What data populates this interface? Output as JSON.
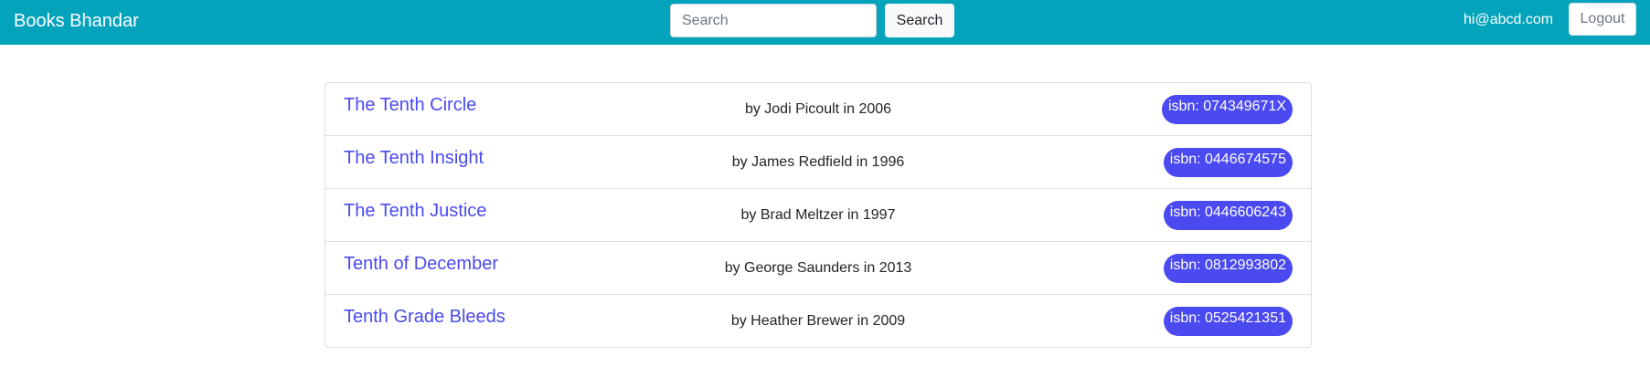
{
  "navbar": {
    "brand": "Books Bhandar",
    "search_placeholder": "Search",
    "search_value": "",
    "search_button_label": "Search",
    "user_email": "hi@abcd.com",
    "logout_label": "Logout"
  },
  "books": [
    {
      "title": "The Tenth Circle",
      "byline": "by Jodi Picoult in 2006",
      "isbn": "isbn: 074349671X"
    },
    {
      "title": "The Tenth Insight",
      "byline": "by James Redfield in 1996",
      "isbn": "isbn: 0446674575"
    },
    {
      "title": "The Tenth Justice",
      "byline": "by Brad Meltzer in 1997",
      "isbn": "isbn: 0446606243"
    },
    {
      "title": "Tenth of December",
      "byline": "by George Saunders in 2013",
      "isbn": "isbn: 0812993802"
    },
    {
      "title": "Tenth Grade Bleeds",
      "byline": "by Heather Brewer in 2009",
      "isbn": "isbn: 0525421351"
    }
  ],
  "colors": {
    "navbar_bg": "#04a3bc",
    "link": "#4a4af0",
    "badge_bg": "#4a4af0"
  }
}
